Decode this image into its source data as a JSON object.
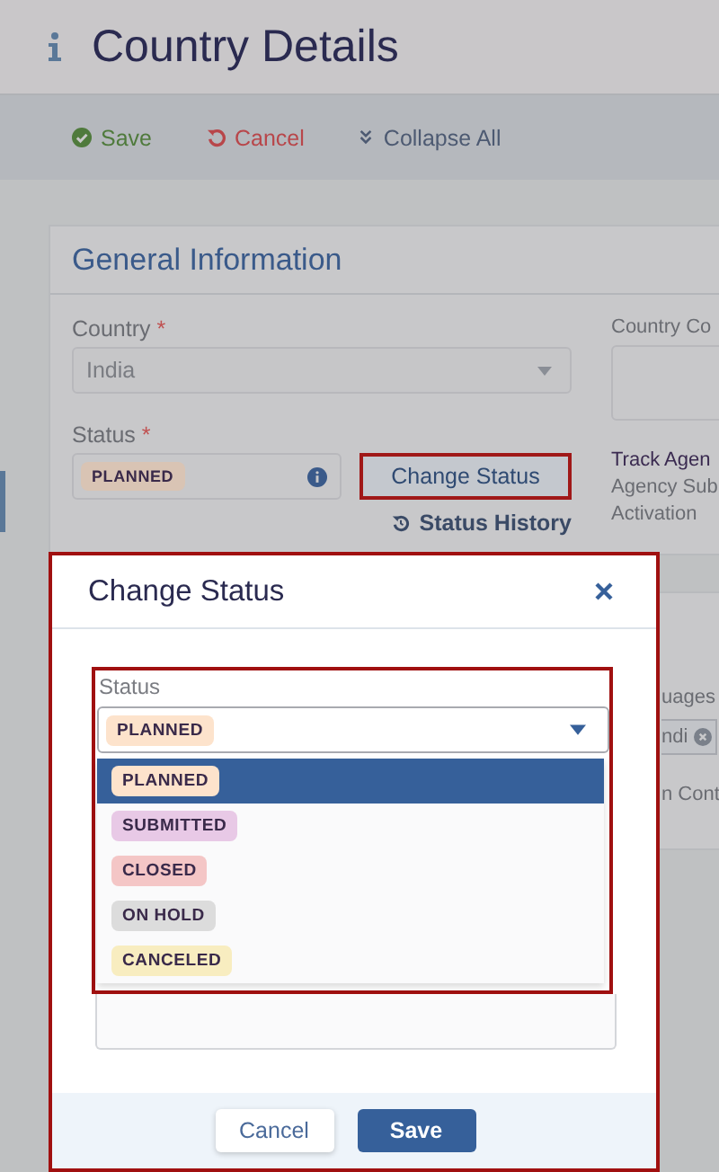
{
  "header": {
    "title": "Country Details"
  },
  "toolbar": [
    {
      "kind": "save",
      "label": "Save"
    },
    {
      "kind": "cancel",
      "label": "Cancel"
    },
    {
      "kind": "collapse",
      "label": "Collapse All"
    }
  ],
  "card": {
    "title": "General Information",
    "country": {
      "label": "Country",
      "required_mark": "*",
      "value": "India"
    },
    "status": {
      "label": "Status",
      "required_mark": "*",
      "value": "PLANNED",
      "color": "#d9c4b4"
    },
    "change_status_button": "Change Status",
    "status_history_link": "Status History",
    "country_code_label": "Country Co",
    "track_label": "Track Agen",
    "agency_lines": [
      "Agency Sub",
      "Activation"
    ]
  },
  "second_card": {
    "languages_label": "uages",
    "language_chip": "ndi",
    "label_3": "n Cont"
  },
  "modal": {
    "title": "Change Status",
    "field_label": "Status",
    "selected_value": "PLANNED",
    "options": [
      {
        "label": "PLANNED",
        "color": "#fde3cc",
        "selected": true
      },
      {
        "label": "SUBMITTED",
        "color": "#e8c9e6",
        "selected": false
      },
      {
        "label": "CLOSED",
        "color": "#f4c6c6",
        "selected": false
      },
      {
        "label": "ON HOLD",
        "color": "#dcdcdc",
        "selected": false
      },
      {
        "label": "CANCELED",
        "color": "#f8edc0",
        "selected": false
      }
    ],
    "buttons": {
      "cancel": "Cancel",
      "save": "Save"
    }
  }
}
